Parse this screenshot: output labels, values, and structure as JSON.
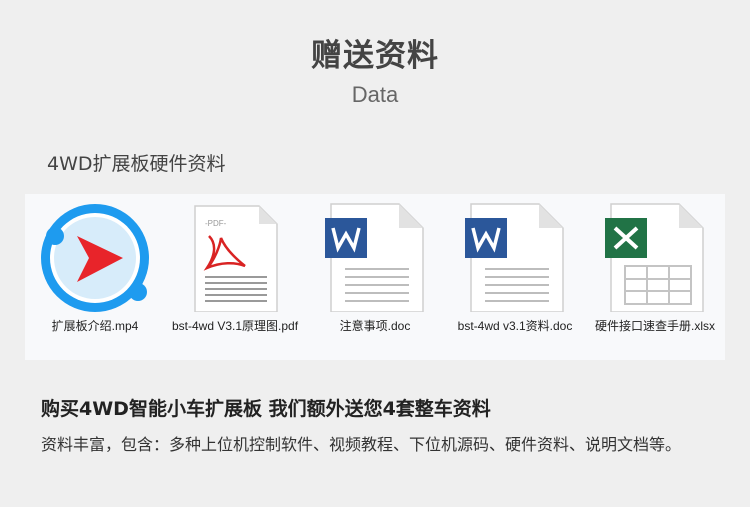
{
  "header": {
    "title": "赠送资料",
    "subtitle": "Data"
  },
  "section": {
    "title": "4WD扩展板硬件资料"
  },
  "files": [
    {
      "name": "扩展板介绍.mp4",
      "icon": "video-player-icon"
    },
    {
      "name": "bst-4wd V3.1原理图.pdf",
      "icon": "pdf-file-icon"
    },
    {
      "name": "注意事项.doc",
      "icon": "word-doc-icon"
    },
    {
      "name": "bst-4wd v3.1资料.doc",
      "icon": "word-doc-icon"
    },
    {
      "name": "硬件接口速查手册.xlsx",
      "icon": "excel-sheet-icon"
    }
  ],
  "promo": {
    "title": "购买4WD智能小车扩展板 我们额外送您4套整车资料",
    "description": "资料丰富，包含：多种上位机控制软件、视频教程、下位机源码、硬件资料、说明文档等。"
  },
  "colors": {
    "word": "#2b579a",
    "excel": "#217346",
    "video_ring": "#1e9bef",
    "play": "#e8242a"
  }
}
